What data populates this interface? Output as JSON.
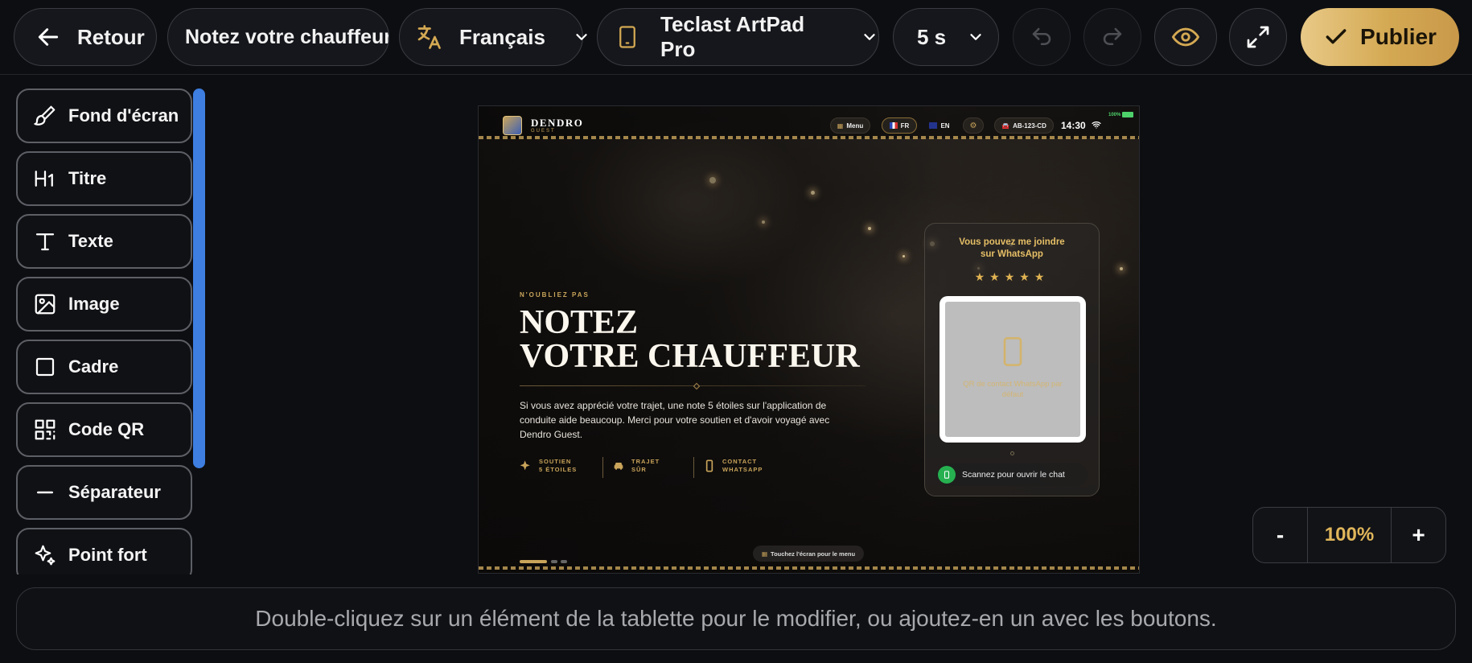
{
  "toolbar": {
    "back_label": "Retour",
    "page_name": "Notez votre chauffeur",
    "language": "Français",
    "device": "Teclast ArtPad Pro",
    "duration": "5 s",
    "publish_label": "Publier"
  },
  "tools": [
    {
      "label": "Fond d'écran",
      "icon": "brush-icon"
    },
    {
      "label": "Titre",
      "icon": "heading-icon"
    },
    {
      "label": "Texte",
      "icon": "text-icon"
    },
    {
      "label": "Image",
      "icon": "image-icon"
    },
    {
      "label": "Cadre",
      "icon": "frame-icon"
    },
    {
      "label": "Code QR",
      "icon": "qr-code-icon"
    },
    {
      "label": "Séparateur",
      "icon": "separator-icon"
    },
    {
      "label": "Point fort",
      "icon": "sparkle-icon"
    }
  ],
  "tablet": {
    "brand": "DENDRO",
    "brand_sub": "GUEST",
    "menu": "Menu",
    "lang_fr": "FR",
    "lang_en": "EN",
    "plate": "AB-123-CD",
    "time": "14:30",
    "battery": "100%",
    "eyebrow": "N'OUBLIEZ PAS",
    "title_line1": "NOTEZ",
    "title_line2": "VOTRE CHAUFFEUR",
    "description": "Si vous avez apprécié votre trajet, une note 5 étoiles sur l'application de conduite aide beaucoup. Merci pour votre soutien et d'avoir voyagé avec Dendro Guest.",
    "features": [
      {
        "line1": "SOUTIEN",
        "line2": "5 ÉTOILES",
        "icon": "sparkle-icon"
      },
      {
        "line1": "TRAJET",
        "line2": "SÛR",
        "icon": "car-icon"
      },
      {
        "line1": "CONTACT",
        "line2": "WHATSAPP",
        "icon": "phone-icon"
      }
    ],
    "card_title_line1": "Vous pouvez me joindre",
    "card_title_line2": "sur WhatsApp",
    "stars": "★★★★★",
    "qr_placeholder": "QR de contact WhatsApp par défaut",
    "scan_label": "Scannez pour ouvrir le chat",
    "touch_hint": "Touchez l'écran pour le menu"
  },
  "zoom": {
    "minus": "-",
    "value": "100%",
    "plus": "+"
  },
  "hint": "Double-cliquez sur un élément de la tablette pour le modifier, ou ajoutez-en un avec les boutons.",
  "colors": {
    "accent_gold": "#d4a953",
    "scrollbar": "#3d7ee0",
    "whatsapp": "#26b050"
  }
}
